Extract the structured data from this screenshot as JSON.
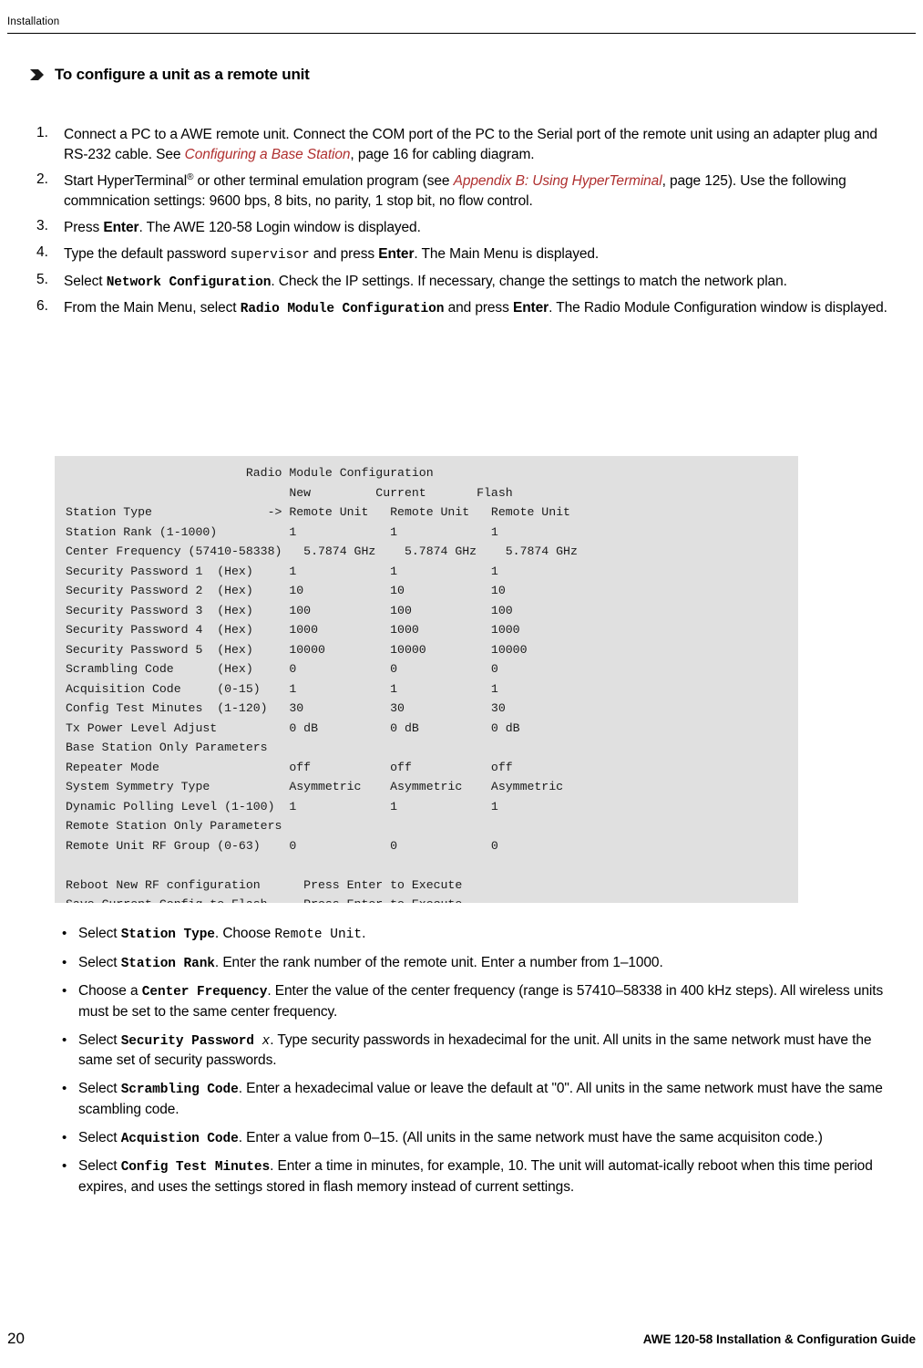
{
  "header": {
    "title": "Installation"
  },
  "section": {
    "arrow_icon": "right-arrow-bullet-icon",
    "title": "To configure a unit as a remote unit"
  },
  "steps": [
    {
      "num": "1.",
      "parts": [
        {
          "t": "Connect a PC to a AWE remote unit. Connect the COM port of the PC to the Serial port of the remote unit using an adapter plug and RS-232 cable. See ",
          "s": "plain"
        },
        {
          "t": "Configuring a Base Station",
          "s": "xref"
        },
        {
          "t": ", page 16 for cabling diagram.",
          "s": "plain"
        }
      ]
    },
    {
      "num": "2.",
      "parts": [
        {
          "t": "Start HyperTerminal",
          "s": "plain"
        },
        {
          "t": "®",
          "s": "sup"
        },
        {
          "t": " or other terminal emulation program (see ",
          "s": "plain"
        },
        {
          "t": "Appendix B: Using HyperTerminal",
          "s": "xref"
        },
        {
          "t": ", page 125). Use the following commnication settings: 9600 bps, 8 bits, no parity, 1 stop bit, no flow control.",
          "s": "plain"
        }
      ]
    },
    {
      "num": "3.",
      "parts": [
        {
          "t": "Press ",
          "s": "plain"
        },
        {
          "t": "Enter",
          "s": "bold"
        },
        {
          "t": ". The AWE 120-58 Login window is displayed.",
          "s": "plain"
        }
      ]
    },
    {
      "num": "4.",
      "parts": [
        {
          "t": "Type the default password ",
          "s": "plain"
        },
        {
          "t": "supervisor",
          "s": "mono"
        },
        {
          "t": " and press ",
          "s": "plain"
        },
        {
          "t": "Enter",
          "s": "bold"
        },
        {
          "t": ". The Main Menu is displayed.",
          "s": "plain"
        }
      ]
    },
    {
      "num": "5.",
      "parts": [
        {
          "t": "Select ",
          "s": "plain"
        },
        {
          "t": "Network Configuration",
          "s": "monob"
        },
        {
          "t": ". Check the IP settings. If necessary, change the settings to match the network plan.",
          "s": "plain"
        }
      ]
    },
    {
      "num": "6.",
      "parts": [
        {
          "t": "From the Main Menu, select ",
          "s": "plain"
        },
        {
          "t": "Radio Module Configuration",
          "s": "monob"
        },
        {
          "t": " and press ",
          "s": "plain"
        },
        {
          "t": "Enter",
          "s": "bold"
        },
        {
          "t": ". The Radio Module Configuration window is displayed.",
          "s": "plain"
        }
      ]
    }
  ],
  "terminal": {
    "title": "Radio Module Configuration",
    "lines": [
      "                         Radio Module Configuration",
      "                               New         Current       Flash",
      "Station Type                -> Remote Unit   Remote Unit   Remote Unit",
      "Station Rank (1-1000)          1             1             1",
      "Center Frequency (57410-58338)   5.7874 GHz    5.7874 GHz    5.7874 GHz",
      "Security Password 1  (Hex)     1             1             1",
      "Security Password 2  (Hex)     10            10            10",
      "Security Password 3  (Hex)     100           100           100",
      "Security Password 4  (Hex)     1000          1000          1000",
      "Security Password 5  (Hex)     10000         10000         10000",
      "Scrambling Code      (Hex)     0             0             0",
      "Acquisition Code     (0-15)    1             1             1",
      "Config Test Minutes  (1-120)   30            30            30",
      "Tx Power Level Adjust          0 dB          0 dB          0 dB",
      "Base Station Only Parameters",
      "Repeater Mode                  off           off           off",
      "System Symmetry Type           Asymmetric    Asymmetric    Asymmetric",
      "Dynamic Polling Level (1-100)  1             1             1",
      "Remote Station Only Parameters",
      "Remote Unit RF Group (0-63)    0             0             0",
      "",
      "Reboot New RF configuration      Press Enter to Execute",
      "Save Current Config to Flash     Press Enter to Execute"
    ]
  },
  "bullets": [
    {
      "parts": [
        {
          "t": "Select ",
          "s": "plain"
        },
        {
          "t": "Station Type",
          "s": "monob"
        },
        {
          "t": ". Choose ",
          "s": "plain"
        },
        {
          "t": "Remote Unit",
          "s": "mono"
        },
        {
          "t": ".",
          "s": "plain"
        }
      ]
    },
    {
      "parts": [
        {
          "t": "Select ",
          "s": "plain"
        },
        {
          "t": "Station Rank",
          "s": "monob"
        },
        {
          "t": ". Enter the rank number of the remote unit. Enter a number from 1–1000.",
          "s": "plain"
        }
      ]
    },
    {
      "parts": [
        {
          "t": "Choose a ",
          "s": "plain"
        },
        {
          "t": "Center Frequency",
          "s": "monob"
        },
        {
          "t": ". Enter the value of the center frequency (range is 57410–58338 in 400 kHz steps).  All wireless units must be set to the same center frequency.",
          "s": "plain"
        }
      ]
    },
    {
      "parts": [
        {
          "t": "Select ",
          "s": "plain"
        },
        {
          "t": "Security Password ",
          "s": "monob"
        },
        {
          "t": "x",
          "s": "monoital"
        },
        {
          "t": ". Type security passwords in hexadecimal for the unit. All units in the same network must have the same set of security passwords.",
          "s": "plain"
        }
      ]
    },
    {
      "parts": [
        {
          "t": "Select ",
          "s": "plain"
        },
        {
          "t": "Scrambling Code",
          "s": "monob"
        },
        {
          "t": ". Enter a hexadecimal value or leave the default at \"0\". All units in the same network must have the same scambling code.",
          "s": "plain"
        }
      ]
    },
    {
      "parts": [
        {
          "t": "Select ",
          "s": "plain"
        },
        {
          "t": "Acquistion Code",
          "s": "monob"
        },
        {
          "t": ". Enter a value from 0–15. (All units in the same network must have the same acquisiton code.)",
          "s": "plain"
        }
      ]
    },
    {
      "parts": [
        {
          "t": "Select ",
          "s": "plain"
        },
        {
          "t": "Config Test Minutes",
          "s": "monob"
        },
        {
          "t": ". Enter a time in minutes, for example, 10. The unit will automat-ically reboot when this time period expires, and uses the settings stored in flash memory instead of current settings.",
          "s": "plain"
        }
      ]
    }
  ],
  "footer": {
    "page_number": "20",
    "guide_title": "AWE 120-58 Installation & Configuration Guide"
  },
  "colors": {
    "xref": "#B03030",
    "terminal_bg": "#E0E0E0",
    "arrow": "#1a1a1a"
  }
}
